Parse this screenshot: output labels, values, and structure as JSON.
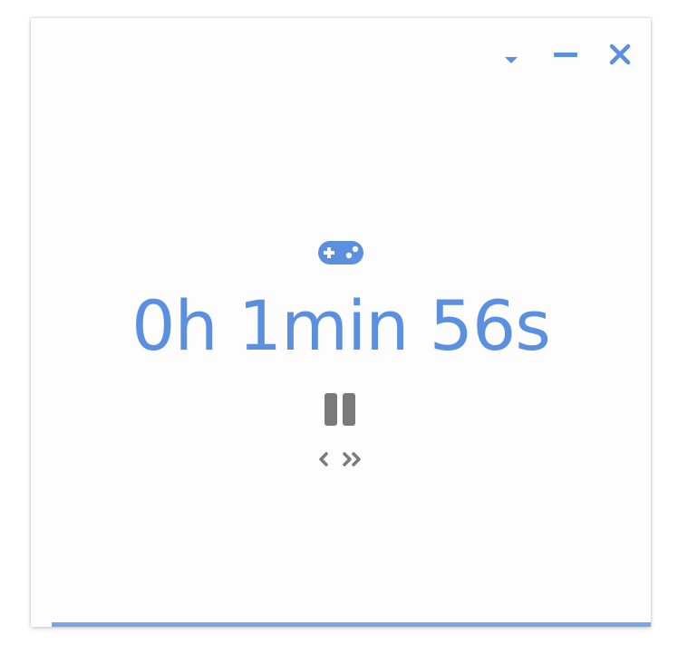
{
  "window": {
    "controls": {
      "dropdown_icon": "caret-down-icon",
      "minimize_icon": "minus-icon",
      "close_icon": "close-icon"
    }
  },
  "timer": {
    "activity_icon": "gamepad-icon",
    "elapsed": "0h 1min 56s",
    "pause_icon": "pause-icon",
    "prev_icon": "chevron-left-icon",
    "next_icon": "double-chevron-right-icon"
  },
  "progress": {
    "fraction": 1.0
  },
  "colors": {
    "accent": "#5b8fe0",
    "control_gray": "#7a7a7a",
    "progress": "#7ba6e8",
    "window_bg": "#fdfdfd"
  }
}
